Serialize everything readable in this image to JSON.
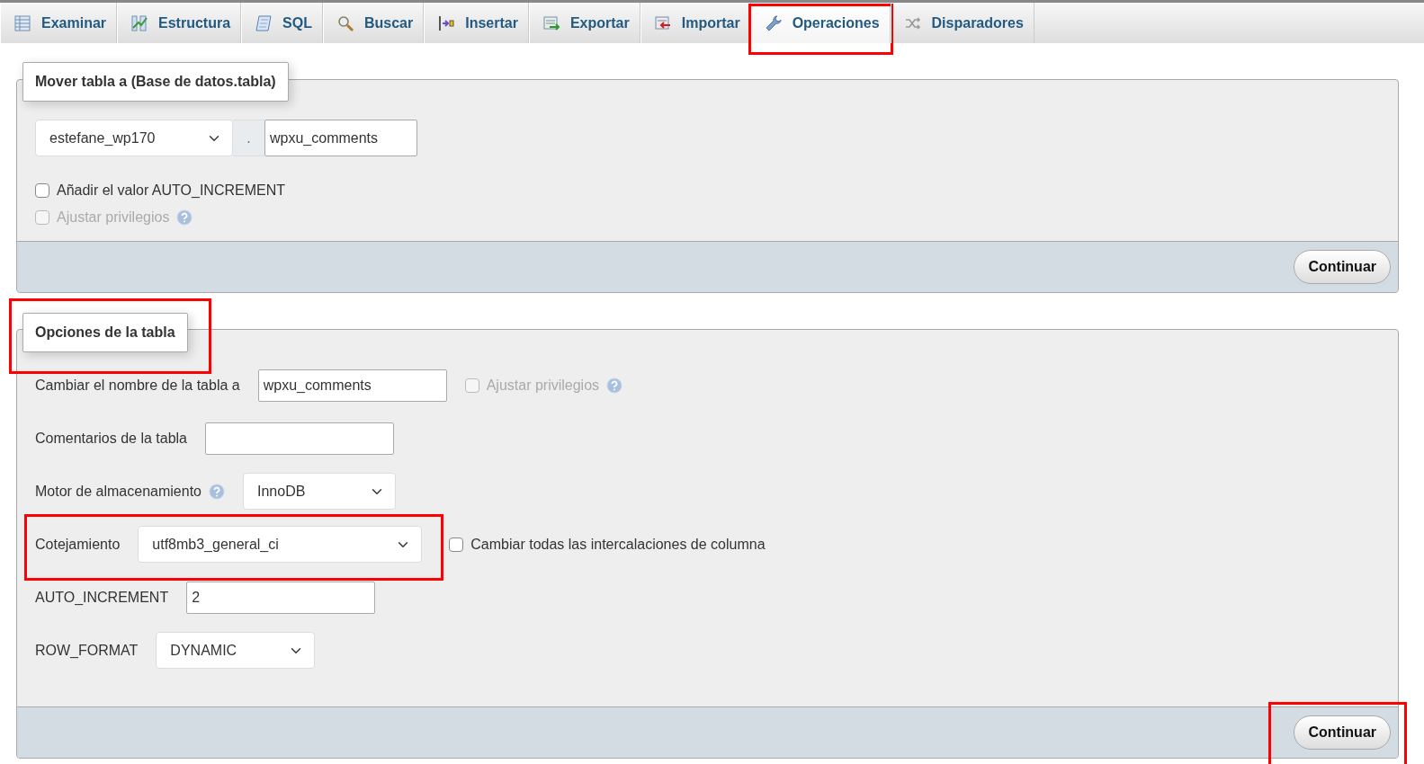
{
  "tabs": [
    {
      "label": "Examinar",
      "selected": false,
      "highlighted": false
    },
    {
      "label": "Estructura",
      "selected": false,
      "highlighted": false
    },
    {
      "label": "SQL",
      "selected": false,
      "highlighted": false
    },
    {
      "label": "Buscar",
      "selected": false,
      "highlighted": false
    },
    {
      "label": "Insertar",
      "selected": false,
      "highlighted": false
    },
    {
      "label": "Exportar",
      "selected": false,
      "highlighted": false
    },
    {
      "label": "Importar",
      "selected": false,
      "highlighted": false
    },
    {
      "label": "Operaciones",
      "selected": true,
      "highlighted": true
    },
    {
      "label": "Disparadores",
      "selected": false,
      "highlighted": false
    }
  ],
  "move_table": {
    "legend": "Mover tabla a (Base de datos.tabla)",
    "highlighted": false,
    "database_select": {
      "value": "estefane_wp170"
    },
    "separator": ".",
    "table_input": {
      "value": "wpxu_comments"
    },
    "checkboxes": [
      {
        "label": "Añadir el valor AUTO_INCREMENT",
        "checked": false,
        "disabled": false,
        "help": false
      },
      {
        "label": "Ajustar privilegios",
        "checked": false,
        "disabled": true,
        "help": true
      }
    ],
    "button": {
      "label": "Continuar",
      "highlighted": false
    }
  },
  "table_options": {
    "legend": "Opciones de la tabla",
    "highlighted": true,
    "rows": [
      {
        "kind": "text",
        "label": "Cambiar el nombre de la tabla a",
        "value": "wpxu_comments",
        "help": false,
        "highlighted": false,
        "checkbox": {
          "label": "Ajustar privilegios",
          "checked": false,
          "disabled": true,
          "help": true
        }
      },
      {
        "kind": "text",
        "label": "Comentarios de la tabla",
        "help": false,
        "highlighted": false
      },
      {
        "kind": "select",
        "label": "Motor de almacenamiento",
        "value": "InnoDB",
        "help": true,
        "highlighted": false
      },
      {
        "kind": "select",
        "label": "Cotejamiento",
        "value": "utf8mb3_general_ci",
        "help": false,
        "highlighted": true,
        "checkbox": {
          "label": "Cambiar todas las intercalaciones de columna",
          "checked": false,
          "disabled": false,
          "help": false
        }
      },
      {
        "kind": "text",
        "label": "AUTO_INCREMENT",
        "value": "2",
        "help": false,
        "highlighted": false
      },
      {
        "kind": "select",
        "label": "ROW_FORMAT",
        "value": "DYNAMIC",
        "help": false,
        "highlighted": false
      }
    ],
    "button": {
      "label": "Continuar",
      "highlighted": true
    }
  }
}
